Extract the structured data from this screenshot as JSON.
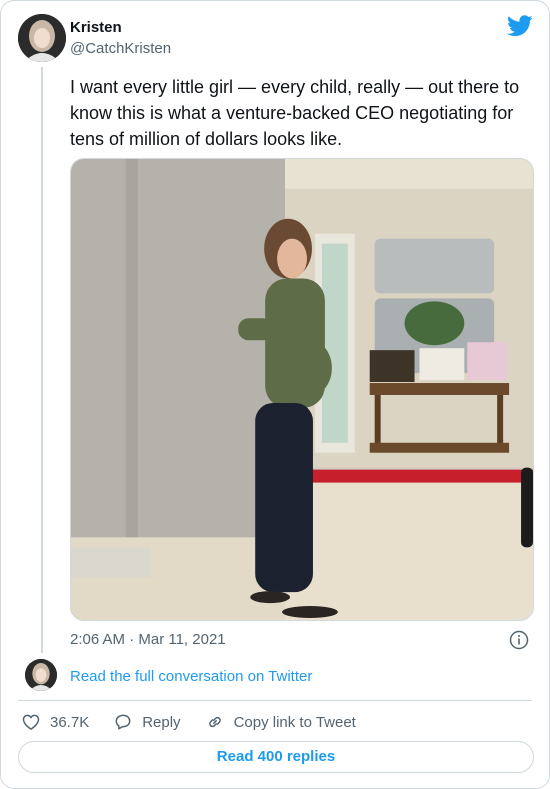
{
  "author": {
    "display_name": "Kristen",
    "handle": "@CatchKristen"
  },
  "tweet": {
    "text": "I want every little girl — every child, really — out there to know this is what a venture-backed CEO negotiating for tens of million of dollars looks like.",
    "timestamp": "2:06 AM · Mar 11, 2021"
  },
  "conversation_link": "Read the full conversation on Twitter",
  "actions": {
    "like_count": "36.7K",
    "reply_label": "Reply",
    "copy_label": "Copy link to Tweet"
  },
  "replies_button": "Read 400 replies",
  "icons": {
    "brand": "twitter-bird-icon",
    "info": "info-icon",
    "like": "heart-icon",
    "reply": "speech-bubble-icon",
    "copy": "link-icon"
  },
  "colors": {
    "brand": "#1d9bf0",
    "text": "#0f1419",
    "secondary": "#536471",
    "border": "#cfd9de"
  }
}
